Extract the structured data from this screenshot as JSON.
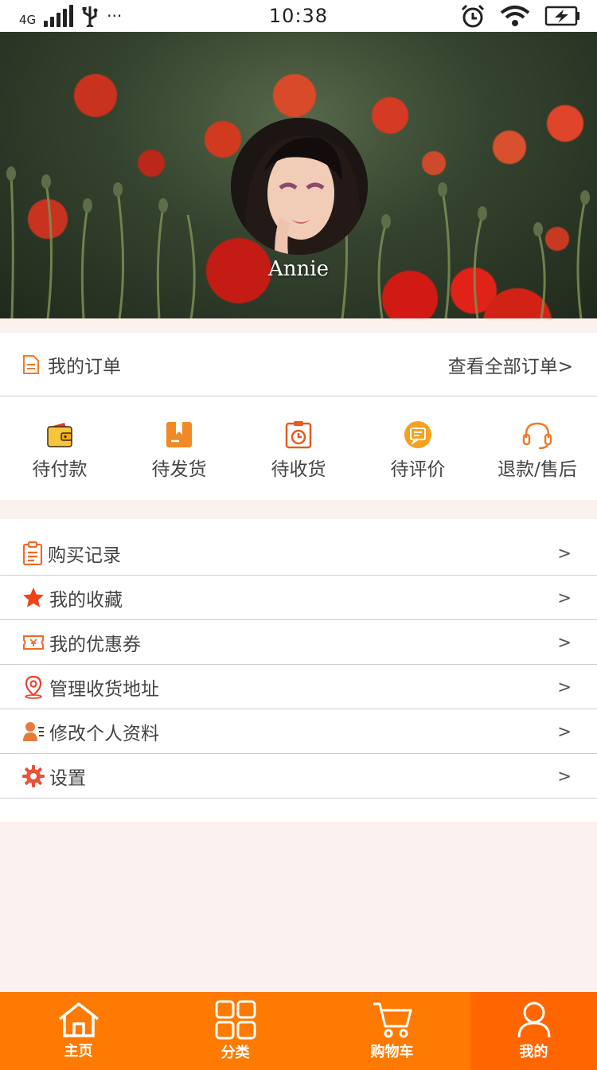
{
  "status_bar": {
    "network": "4G",
    "more": "···",
    "time": "10:38"
  },
  "profile": {
    "name": "Annie"
  },
  "orders": {
    "title": "我的订单",
    "view_all": "查看全部订单>",
    "items": [
      {
        "label": "待付款",
        "icon": "wallet-icon"
      },
      {
        "label": "待发货",
        "icon": "package-icon"
      },
      {
        "label": "待收货",
        "icon": "clipboard-clock-icon"
      },
      {
        "label": "待评价",
        "icon": "comment-icon"
      },
      {
        "label": "退款/售后",
        "icon": "headset-icon"
      }
    ]
  },
  "menu": {
    "chevron": ">",
    "items": [
      {
        "label": "购买记录",
        "icon": "clipboard-icon"
      },
      {
        "label": "我的收藏",
        "icon": "star-icon"
      },
      {
        "label": "我的优惠券",
        "icon": "coupon-icon"
      },
      {
        "label": "管理收货地址",
        "icon": "location-pin-icon"
      },
      {
        "label": "修改个人资料",
        "icon": "user-profile-icon"
      },
      {
        "label": "设置",
        "icon": "gear-icon"
      }
    ]
  },
  "tab_bar": {
    "active": "我的",
    "items": [
      {
        "label": "主页",
        "icon": "home-icon"
      },
      {
        "label": "分类",
        "icon": "grid-icon"
      },
      {
        "label": "购物车",
        "icon": "cart-icon"
      },
      {
        "label": "我的",
        "icon": "person-icon"
      }
    ]
  },
  "colors": {
    "accent": "#ff6600",
    "tab_bar": "#fe7a00",
    "page_bg": "#fbf1ef",
    "icon_orange": "#f07a2a",
    "star_red": "#f0431a"
  }
}
